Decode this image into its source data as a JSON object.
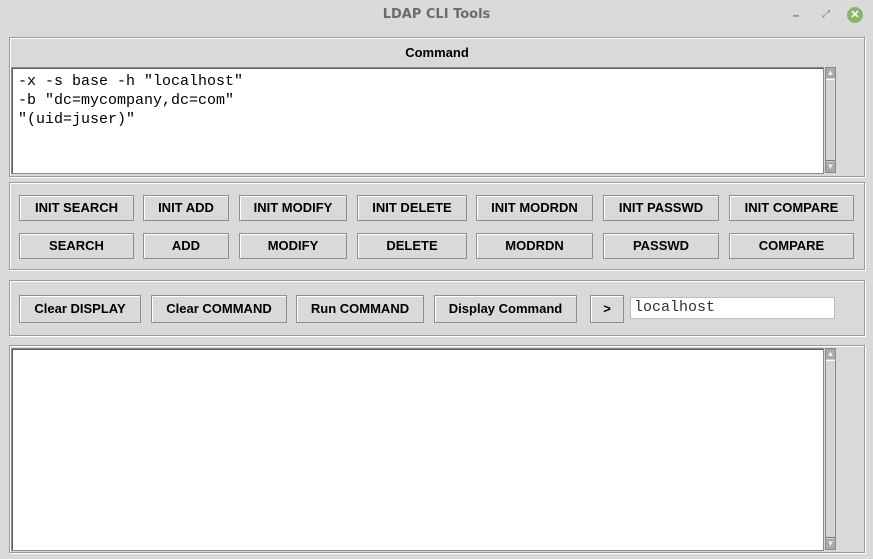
{
  "window": {
    "title": "LDAP CLI Tools",
    "controls": {
      "minimize": "–",
      "maximize": "⤢",
      "close": "✕"
    }
  },
  "command_section": {
    "label": "Command",
    "text": "-x -s base -h \"localhost\"\n-b \"dc=mycompany,dc=com\"\n\"(uid=juser)\""
  },
  "init_buttons": [
    "INIT SEARCH",
    "INIT ADD",
    "INIT MODIFY",
    "INIT DELETE",
    "INIT MODRDN",
    "INIT PASSWD",
    "INIT COMPARE"
  ],
  "action_buttons": [
    "SEARCH",
    "ADD",
    "MODIFY",
    "DELETE",
    "MODRDN",
    "PASSWD",
    "COMPARE"
  ],
  "run_bar": {
    "clear_display": "Clear DISPLAY",
    "clear_command": "Clear COMMAND",
    "run_command": "Run COMMAND",
    "display_command": "Display Command",
    "go": ">",
    "host_value": "localhost"
  },
  "display_section": {
    "text": ""
  },
  "scrollbar": {
    "up": "▲",
    "down": "▼"
  }
}
